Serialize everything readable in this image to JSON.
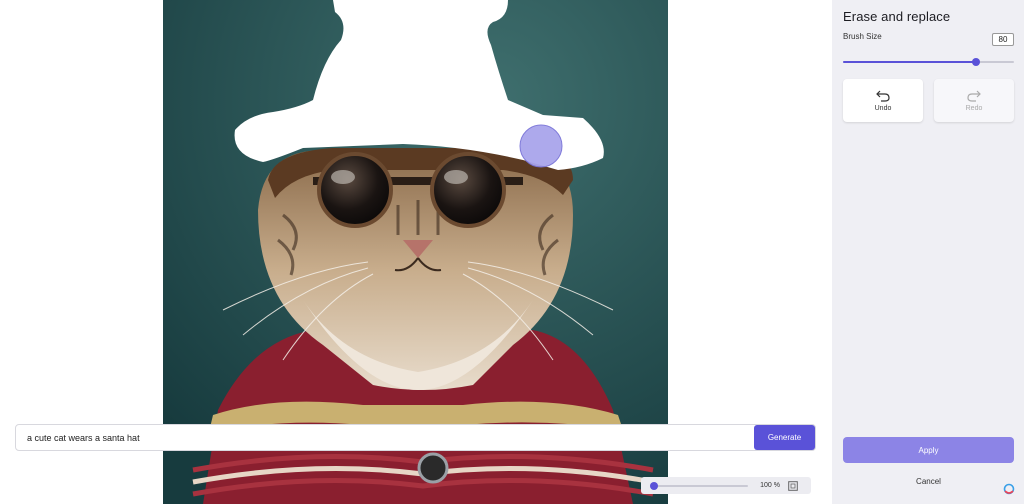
{
  "panel": {
    "title": "Erase and replace",
    "brush_size_label": "Brush Size",
    "brush_size_value": "80",
    "brush_size_fraction": 0.78,
    "undo_label": "Undo",
    "redo_label": "Redo",
    "apply_label": "Apply",
    "cancel_label": "Cancel"
  },
  "prompt": {
    "value": "a cute cat wears a santa hat",
    "generate_label": "Generate"
  },
  "zoom": {
    "label": "100 %",
    "fraction": 0.03
  },
  "icons": {
    "undo": "undo-arrow-icon",
    "redo": "redo-arrow-icon",
    "fit": "fit-screen-icon",
    "brand": "brand-logo-icon"
  },
  "colors": {
    "accent": "#5a52d8",
    "apply": "#8c84e6",
    "panel_bg": "#efeff4",
    "brush_cursor": "#a9a5ec"
  }
}
